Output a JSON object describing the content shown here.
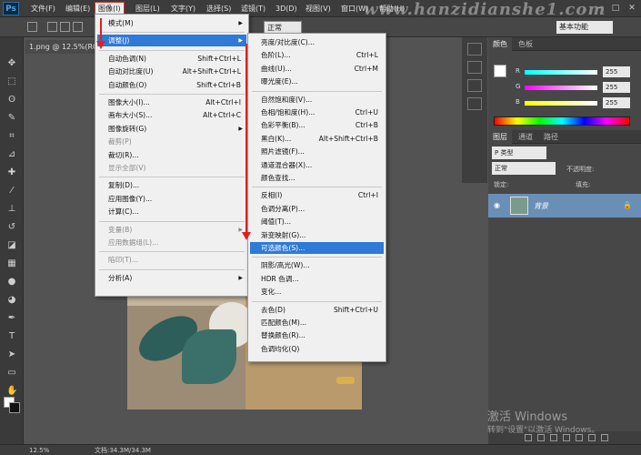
{
  "app": {
    "logo": "Ps",
    "watermark": "www.hanzidianshe1.com"
  },
  "menubar": {
    "items": [
      "文件(F)",
      "编辑(E)",
      "图像(I)",
      "图层(L)",
      "文字(Y)",
      "选择(S)",
      "滤镜(T)",
      "3D(D)",
      "视图(V)",
      "窗口(W)",
      "帮助(H)"
    ],
    "active_index": 2
  },
  "optionsbar": {
    "mode_select": "正常",
    "workspace_select": "基本功能"
  },
  "document": {
    "tab_title": "1.png @ 12.5%(RGB/8#)"
  },
  "statusbar": {
    "zoom": "12.5%",
    "doc_info": "文档:34.3M/34.3M"
  },
  "image_menu": {
    "items": [
      {
        "label": "模式(M)",
        "shortcut": "",
        "submenu": true,
        "disabled": false,
        "highlight": false
      },
      {
        "sep": true
      },
      {
        "label": "调整(J)",
        "shortcut": "",
        "submenu": true,
        "disabled": false,
        "highlight": true
      },
      {
        "sep": true
      },
      {
        "label": "自动色调(N)",
        "shortcut": "Shift+Ctrl+L",
        "submenu": false,
        "disabled": false,
        "highlight": false
      },
      {
        "label": "自动对比度(U)",
        "shortcut": "Alt+Shift+Ctrl+L",
        "submenu": false,
        "disabled": false,
        "highlight": false
      },
      {
        "label": "自动颜色(O)",
        "shortcut": "Shift+Ctrl+B",
        "submenu": false,
        "disabled": false,
        "highlight": false
      },
      {
        "sep": true
      },
      {
        "label": "图像大小(I)...",
        "shortcut": "Alt+Ctrl+I",
        "submenu": false,
        "disabled": false,
        "highlight": false
      },
      {
        "label": "画布大小(S)...",
        "shortcut": "Alt+Ctrl+C",
        "submenu": false,
        "disabled": false,
        "highlight": false
      },
      {
        "label": "图像旋转(G)",
        "shortcut": "",
        "submenu": true,
        "disabled": false,
        "highlight": false
      },
      {
        "label": "裁剪(P)",
        "shortcut": "",
        "submenu": false,
        "disabled": true,
        "highlight": false
      },
      {
        "label": "裁切(R)...",
        "shortcut": "",
        "submenu": false,
        "disabled": false,
        "highlight": false
      },
      {
        "label": "显示全部(V)",
        "shortcut": "",
        "submenu": false,
        "disabled": true,
        "highlight": false
      },
      {
        "sep": true
      },
      {
        "label": "复制(D)...",
        "shortcut": "",
        "submenu": false,
        "disabled": false,
        "highlight": false
      },
      {
        "label": "应用图像(Y)...",
        "shortcut": "",
        "submenu": false,
        "disabled": false,
        "highlight": false
      },
      {
        "label": "计算(C)...",
        "shortcut": "",
        "submenu": false,
        "disabled": false,
        "highlight": false
      },
      {
        "sep": true
      },
      {
        "label": "变量(B)",
        "shortcut": "",
        "submenu": true,
        "disabled": true,
        "highlight": false
      },
      {
        "label": "应用数据组(L)...",
        "shortcut": "",
        "submenu": false,
        "disabled": true,
        "highlight": false
      },
      {
        "sep": true
      },
      {
        "label": "陷印(T)...",
        "shortcut": "",
        "submenu": false,
        "disabled": true,
        "highlight": false
      },
      {
        "sep": true
      },
      {
        "label": "分析(A)",
        "shortcut": "",
        "submenu": true,
        "disabled": false,
        "highlight": false
      }
    ]
  },
  "adjust_menu": {
    "items": [
      {
        "label": "亮度/对比度(C)...",
        "shortcut": "",
        "highlight": false
      },
      {
        "label": "色阶(L)...",
        "shortcut": "Ctrl+L",
        "highlight": false
      },
      {
        "label": "曲线(U)...",
        "shortcut": "Ctrl+M",
        "highlight": false
      },
      {
        "label": "曝光度(E)...",
        "shortcut": "",
        "highlight": false
      },
      {
        "sep": true
      },
      {
        "label": "自然饱和度(V)...",
        "shortcut": "",
        "highlight": false
      },
      {
        "label": "色相/饱和度(H)...",
        "shortcut": "Ctrl+U",
        "highlight": false
      },
      {
        "label": "色彩平衡(B)...",
        "shortcut": "Ctrl+B",
        "highlight": false
      },
      {
        "label": "黑白(K)...",
        "shortcut": "Alt+Shift+Ctrl+B",
        "highlight": false
      },
      {
        "label": "照片滤镜(F)...",
        "shortcut": "",
        "highlight": false
      },
      {
        "label": "通道混合器(X)...",
        "shortcut": "",
        "highlight": false
      },
      {
        "label": "颜色查找...",
        "shortcut": "",
        "highlight": false
      },
      {
        "sep": true
      },
      {
        "label": "反相(I)",
        "shortcut": "Ctrl+I",
        "highlight": false
      },
      {
        "label": "色调分离(P)...",
        "shortcut": "",
        "highlight": false
      },
      {
        "label": "阈值(T)...",
        "shortcut": "",
        "highlight": false
      },
      {
        "label": "渐变映射(G)...",
        "shortcut": "",
        "highlight": false
      },
      {
        "label": "可选颜色(S)...",
        "shortcut": "",
        "highlight": true
      },
      {
        "sep": true
      },
      {
        "label": "阴影/高光(W)...",
        "shortcut": "",
        "highlight": false
      },
      {
        "label": "HDR 色调...",
        "shortcut": "",
        "highlight": false
      },
      {
        "label": "变化...",
        "shortcut": "",
        "highlight": false
      },
      {
        "sep": true
      },
      {
        "label": "去色(D)",
        "shortcut": "Shift+Ctrl+U",
        "highlight": false
      },
      {
        "label": "匹配颜色(M)...",
        "shortcut": "",
        "highlight": false
      },
      {
        "label": "替换颜色(R)...",
        "shortcut": "",
        "highlight": false
      },
      {
        "label": "色调均化(Q)",
        "shortcut": "",
        "highlight": false
      }
    ]
  },
  "color_panel": {
    "tabs": [
      "颜色",
      "色板"
    ],
    "channels": [
      {
        "label": "R",
        "value": "255",
        "gradient": "linear-gradient(to right,#00ffff,#ffffff)"
      },
      {
        "label": "G",
        "value": "255",
        "gradient": "linear-gradient(to right,#ff00ff,#ffffff)"
      },
      {
        "label": "B",
        "value": "255",
        "gradient": "linear-gradient(to right,#ffff00,#ffffff)"
      }
    ]
  },
  "layers_panel": {
    "tabs": [
      "图层",
      "通道",
      "路径"
    ],
    "kind_filter": "P 类型",
    "blend_mode": "正常",
    "opacity_label": "不透明度:",
    "lock_label": "锁定:",
    "fill_label": "填充:",
    "layer_name": "背景"
  },
  "windows_activation": {
    "title": "激活 Windows",
    "subtitle": "转到\"设置\"以激活 Windows。"
  }
}
